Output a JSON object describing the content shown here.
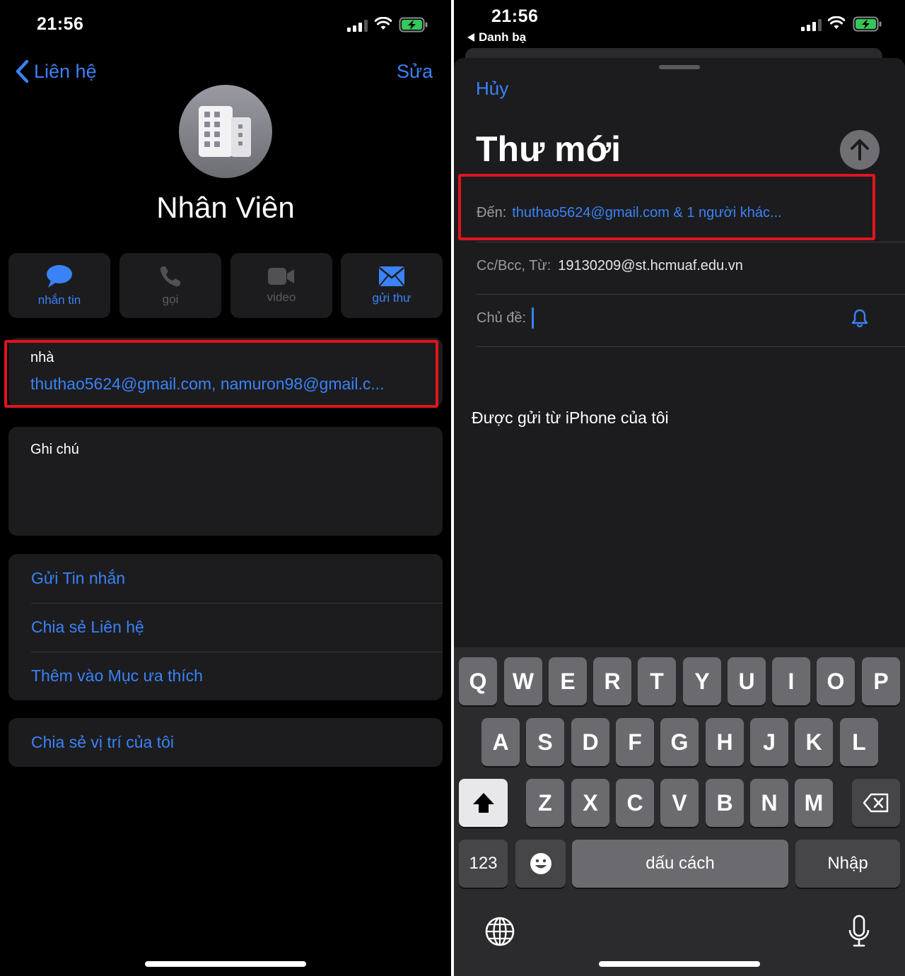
{
  "left": {
    "status": {
      "time": "21:56"
    },
    "nav": {
      "back_label": "Liên hệ",
      "edit_label": "Sửa"
    },
    "contact": {
      "name": "Nhân Viên"
    },
    "actions": [
      {
        "label": "nhắn tin",
        "icon": "message-bubble-icon",
        "enabled": true
      },
      {
        "label": "gọi",
        "icon": "phone-icon",
        "enabled": false
      },
      {
        "label": "video",
        "icon": "video-icon",
        "enabled": false
      },
      {
        "label": "gửi thư",
        "icon": "mail-icon",
        "enabled": true
      }
    ],
    "email_card": {
      "label": "nhà",
      "value": "thuthao5624@gmail.com, namuron98@gmail.c..."
    },
    "notes": {
      "label": "Ghi chú"
    },
    "options": [
      "Gửi Tin nhắn",
      "Chia sẻ Liên hệ",
      "Thêm vào Mục ưa thích"
    ],
    "location": {
      "label": "Chia sẻ vị trí của tôi"
    }
  },
  "right": {
    "status": {
      "time": "21:56",
      "back_app": "Danh bạ"
    },
    "compose": {
      "cancel_label": "Hủy",
      "title": "Thư mới",
      "to_label": "Đến:",
      "to_value": "thuthao5624@gmail.com & 1 người khác...",
      "cc_label": "Cc/Bcc, Từ:",
      "cc_value": "19130209@st.hcmuaf.edu.vn",
      "subject_label": "Chủ đề:",
      "signature": "Được gửi từ iPhone của tôi"
    },
    "keyboard": {
      "row1": [
        "Q",
        "W",
        "E",
        "R",
        "T",
        "Y",
        "U",
        "I",
        "O",
        "P"
      ],
      "row2": [
        "A",
        "S",
        "D",
        "F",
        "G",
        "H",
        "J",
        "K",
        "L"
      ],
      "row3": [
        "Z",
        "X",
        "C",
        "V",
        "B",
        "N",
        "M"
      ],
      "numbers_label": "123",
      "space_label": "dấu cách",
      "return_label": "Nhập"
    }
  },
  "colors": {
    "accent": "#3a82f7",
    "highlight": "#e0141e",
    "card": "#1c1c1e",
    "background": "#000000"
  }
}
